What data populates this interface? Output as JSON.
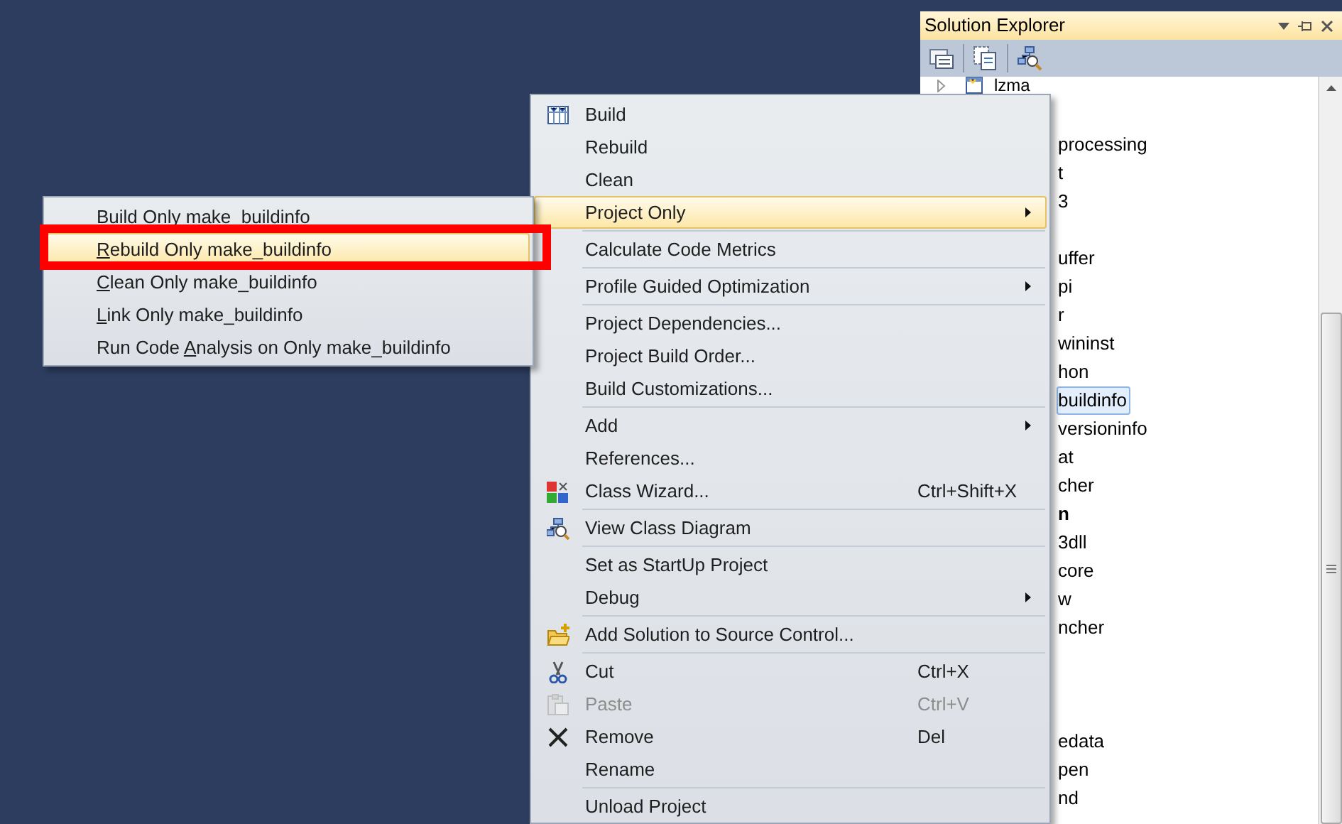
{
  "solution_explorer": {
    "title": "Solution Explorer",
    "tree": [
      {
        "kind": "node",
        "label": "lzma"
      },
      {
        "kind": "blank"
      },
      {
        "kind": "text",
        "label": "processing",
        "selected": false,
        "bold": false
      },
      {
        "kind": "text",
        "label": "t",
        "selected": false,
        "bold": false
      },
      {
        "kind": "text",
        "label": "3",
        "selected": false,
        "bold": false
      },
      {
        "kind": "blank"
      },
      {
        "kind": "text",
        "label": "uffer",
        "selected": false,
        "bold": false
      },
      {
        "kind": "text",
        "label": "pi",
        "selected": false,
        "bold": false
      },
      {
        "kind": "text",
        "label": "r",
        "selected": false,
        "bold": false
      },
      {
        "kind": "text",
        "label": "wininst",
        "selected": false,
        "bold": false
      },
      {
        "kind": "text",
        "label": "hon",
        "selected": false,
        "bold": false
      },
      {
        "kind": "text",
        "label": "buildinfo",
        "selected": true,
        "bold": false
      },
      {
        "kind": "text",
        "label": "versioninfo",
        "selected": false,
        "bold": false
      },
      {
        "kind": "text",
        "label": "at",
        "selected": false,
        "bold": false
      },
      {
        "kind": "text",
        "label": "cher",
        "selected": false,
        "bold": false
      },
      {
        "kind": "text",
        "label": "n",
        "selected": false,
        "bold": true
      },
      {
        "kind": "text",
        "label": "3dll",
        "selected": false,
        "bold": false
      },
      {
        "kind": "text",
        "label": "core",
        "selected": false,
        "bold": false
      },
      {
        "kind": "text",
        "label": "w",
        "selected": false,
        "bold": false
      },
      {
        "kind": "text",
        "label": "ncher",
        "selected": false,
        "bold": false
      },
      {
        "kind": "blank"
      },
      {
        "kind": "blank"
      },
      {
        "kind": "blank"
      },
      {
        "kind": "text",
        "label": "edata",
        "selected": false,
        "bold": false
      },
      {
        "kind": "text",
        "label": "pen",
        "selected": false,
        "bold": false
      },
      {
        "kind": "text",
        "label": "nd",
        "selected": false,
        "bold": false
      }
    ]
  },
  "context_menu": {
    "items": [
      {
        "kind": "item",
        "label": "Build",
        "selected": false,
        "disabled": false,
        "has_submenu": false
      },
      {
        "kind": "item",
        "label": "Rebuild",
        "selected": false,
        "disabled": false,
        "has_submenu": false
      },
      {
        "kind": "item",
        "label": "Clean",
        "selected": false,
        "disabled": false,
        "has_submenu": false
      },
      {
        "kind": "item",
        "label": "Project Only",
        "selected": true,
        "disabled": false,
        "has_submenu": true
      },
      {
        "kind": "separator"
      },
      {
        "kind": "item",
        "label": "Calculate Code Metrics",
        "selected": false,
        "disabled": false,
        "has_submenu": false
      },
      {
        "kind": "separator"
      },
      {
        "kind": "item",
        "label": "Profile Guided Optimization",
        "selected": false,
        "disabled": false,
        "has_submenu": true
      },
      {
        "kind": "separator"
      },
      {
        "kind": "item",
        "label": "Project Dependencies...",
        "selected": false,
        "disabled": false,
        "has_submenu": false
      },
      {
        "kind": "item",
        "label": "Project Build Order...",
        "selected": false,
        "disabled": false,
        "has_submenu": false
      },
      {
        "kind": "item",
        "label": "Build Customizations...",
        "selected": false,
        "disabled": false,
        "has_submenu": false
      },
      {
        "kind": "separator"
      },
      {
        "kind": "item",
        "label": "Add",
        "selected": false,
        "disabled": false,
        "has_submenu": true
      },
      {
        "kind": "item",
        "label": "References...",
        "selected": false,
        "disabled": false,
        "has_submenu": false
      },
      {
        "kind": "item",
        "label": "Class Wizard...",
        "shortcut": "Ctrl+Shift+X",
        "selected": false,
        "disabled": false,
        "has_submenu": false
      },
      {
        "kind": "separator"
      },
      {
        "kind": "item",
        "label": "View Class Diagram",
        "selected": false,
        "disabled": false,
        "has_submenu": false
      },
      {
        "kind": "separator"
      },
      {
        "kind": "item",
        "label": "Set as StartUp Project",
        "selected": false,
        "disabled": false,
        "has_submenu": false
      },
      {
        "kind": "item",
        "label": "Debug",
        "selected": false,
        "disabled": false,
        "has_submenu": true
      },
      {
        "kind": "separator"
      },
      {
        "kind": "item",
        "label": "Add Solution to Source Control...",
        "selected": false,
        "disabled": false,
        "has_submenu": false
      },
      {
        "kind": "separator"
      },
      {
        "kind": "item",
        "label": "Cut",
        "shortcut": "Ctrl+X",
        "selected": false,
        "disabled": false,
        "has_submenu": false
      },
      {
        "kind": "item",
        "label": "Paste",
        "shortcut": "Ctrl+V",
        "selected": false,
        "disabled": true,
        "has_submenu": false
      },
      {
        "kind": "item",
        "label": "Remove",
        "shortcut": "Del",
        "selected": false,
        "disabled": false,
        "has_submenu": false
      },
      {
        "kind": "item",
        "label": "Rename",
        "selected": false,
        "disabled": false,
        "has_submenu": false
      },
      {
        "kind": "separator"
      },
      {
        "kind": "item",
        "label": "Unload Project",
        "selected": false,
        "disabled": false,
        "has_submenu": false
      }
    ]
  },
  "submenu": {
    "items": [
      {
        "label": "Build Only make_buildinfo",
        "selected": false
      },
      {
        "key": "R",
        "rest": "ebuild Only make_buildinfo",
        "selected": true
      },
      {
        "key": "C",
        "rest": "lean Only make_buildinfo",
        "selected": false
      },
      {
        "key": "L",
        "rest": "ink Only make_buildinfo",
        "selected": false
      },
      {
        "prefix": "Run Code ",
        "key": "A",
        "rest": "nalysis on Only make_buildinfo",
        "selected": false
      }
    ]
  }
}
